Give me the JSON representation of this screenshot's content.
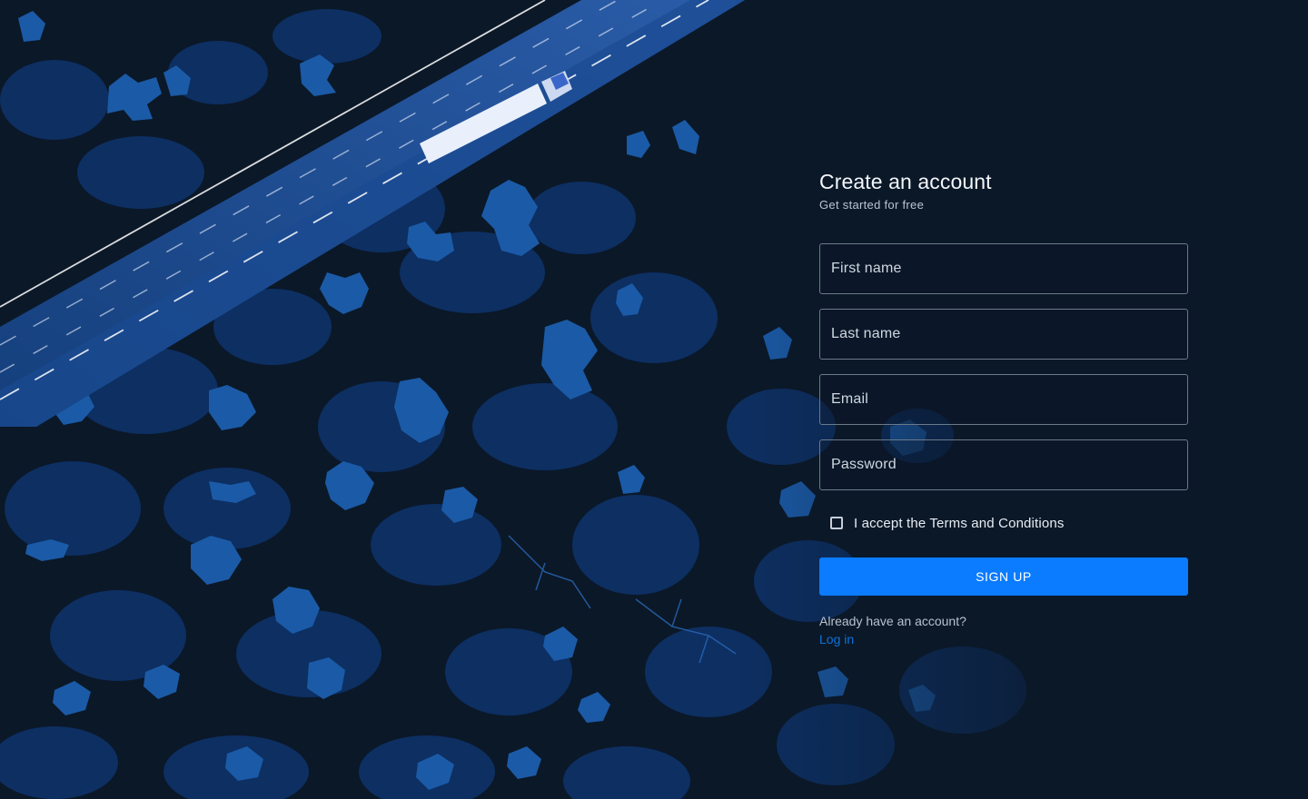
{
  "form": {
    "title": "Create an account",
    "subtitle": "Get started for free",
    "fields": {
      "first_name": {
        "placeholder": "First name",
        "value": ""
      },
      "last_name": {
        "placeholder": "Last name",
        "value": ""
      },
      "email": {
        "placeholder": "Email",
        "value": ""
      },
      "password": {
        "placeholder": "Password",
        "value": ""
      }
    },
    "terms": {
      "label": "I accept the Terms and Conditions",
      "checked": false
    },
    "submit_label": "SIGN UP",
    "login_prompt": "Already have an account?",
    "login_link": "Log in"
  },
  "colors": {
    "background": "#0b1828",
    "accent": "#0b7cff",
    "link": "#0d73db"
  },
  "icons": {
    "hero": "aerial-road-truck-forest",
    "checkbox": "checkbox-unchecked-icon"
  }
}
